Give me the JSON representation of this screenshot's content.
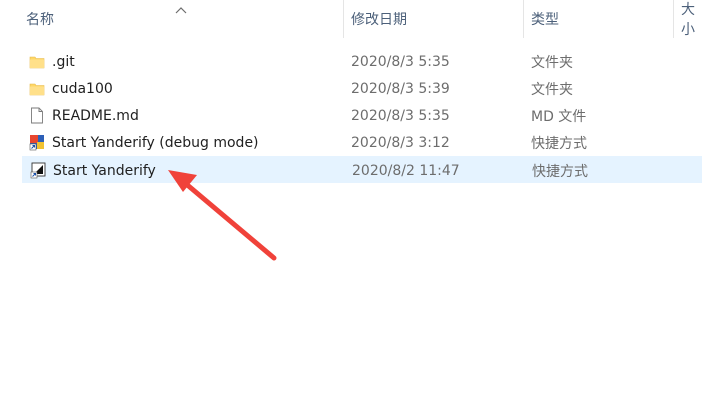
{
  "columns": {
    "name": "名称",
    "date": "修改日期",
    "type": "类型",
    "size": "大小"
  },
  "files": [
    {
      "icon": "folder-icon",
      "name": ".git",
      "date": "2020/8/3 5:35",
      "type": "文件夹"
    },
    {
      "icon": "folder-icon",
      "name": "cuda100",
      "date": "2020/8/3 5:39",
      "type": "文件夹"
    },
    {
      "icon": "document-icon",
      "name": "README.md",
      "date": "2020/8/3 5:35",
      "type": "MD 文件"
    },
    {
      "icon": "shortcut-app-icon",
      "name": "Start Yanderify (debug mode)",
      "date": "2020/8/3 3:12",
      "type": "快捷方式"
    },
    {
      "icon": "shortcut-terminal-icon",
      "name": "Start Yanderify",
      "date": "2020/8/2 11:47",
      "type": "快捷方式"
    }
  ],
  "colors": {
    "selection": "#e5f3ff",
    "arrow": "#f0423a",
    "folder": "#ffd766"
  }
}
